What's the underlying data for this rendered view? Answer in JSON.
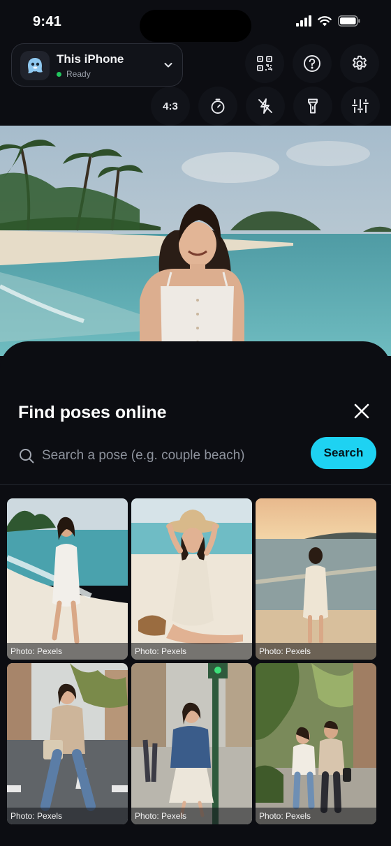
{
  "status_bar": {
    "time": "9:41"
  },
  "device": {
    "name": "This iPhone",
    "status": "Ready",
    "status_color": "#22c55e"
  },
  "controls": {
    "top_row": [
      "qr-code",
      "help",
      "settings"
    ],
    "bottom_row": {
      "aspect_label": "4:3",
      "icons": [
        "timer",
        "flash-off",
        "flashlight",
        "adjustments"
      ]
    }
  },
  "sheet": {
    "title": "Find poses online",
    "search_placeholder": "Search a pose (e.g. couple beach)",
    "search_value": "",
    "search_button": "Search",
    "accent": "#1ed2f2"
  },
  "results": [
    {
      "credit": "Photo: Pexels",
      "scene": "woman-walking-beach"
    },
    {
      "credit": "Photo: Pexels",
      "scene": "woman-sun-hat-sitting-beach"
    },
    {
      "credit": "Photo: Pexels",
      "scene": "woman-back-sunset-beach"
    },
    {
      "credit": "Photo: Pexels",
      "scene": "woman-crosswalk-street"
    },
    {
      "credit": "Photo: Pexels",
      "scene": "woman-denim-jacket-street"
    },
    {
      "credit": "Photo: Pexels",
      "scene": "couple-walking-street"
    }
  ]
}
